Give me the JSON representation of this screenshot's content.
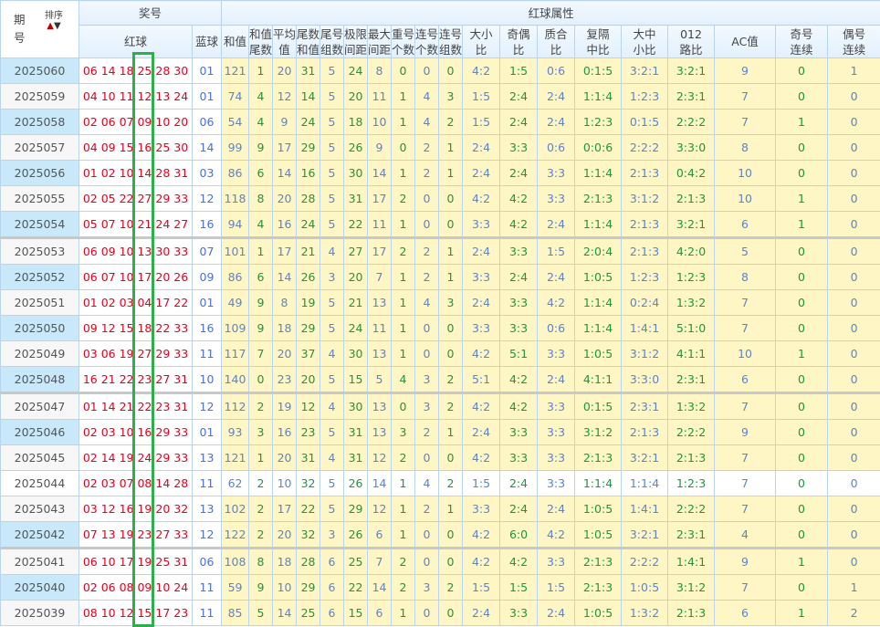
{
  "header": {
    "period_label_1": "期",
    "period_label_2": "号",
    "sort_label": "排序",
    "sort_up_icon": "▲",
    "sort_down_icon": "▼",
    "prize_group": "奖号",
    "attr_group": "红球属性",
    "red_label": "红球",
    "blue_label": "蓝球",
    "columns": [
      [
        "和值",
        ""
      ],
      [
        "和值",
        "尾数"
      ],
      [
        "平均",
        "值"
      ],
      [
        "尾数",
        "和值"
      ],
      [
        "尾号",
        "组数"
      ],
      [
        "极限",
        "间距"
      ],
      [
        "最大",
        "间距"
      ],
      [
        "重号",
        "个数"
      ],
      [
        "连号",
        "个数"
      ],
      [
        "连号",
        "组数"
      ],
      [
        "大小",
        "比"
      ],
      [
        "奇偶",
        "比"
      ],
      [
        "质合",
        "比"
      ],
      [
        "复隔",
        "中比"
      ],
      [
        "大中",
        "小比"
      ],
      [
        "012",
        "路比"
      ],
      [
        "AC值",
        ""
      ],
      [
        "奇号",
        "连续"
      ],
      [
        "偶号",
        "连续"
      ]
    ]
  },
  "colors": {
    "red": "#e8001c",
    "blue": "#4a6fe0",
    "attr_blue": "#5585d6",
    "attr_green": "#179a3c",
    "highlight": "#2db04b",
    "period_alt": "#c9e9fb",
    "attr_bg": "#fff6c6"
  },
  "rows": [
    {
      "period": "2025060",
      "reds": "06 14 18 25 28 30",
      "blue": "01",
      "attrs": [
        "121",
        "1",
        "20",
        "31",
        "5",
        "24",
        "8",
        "0",
        "0",
        "0",
        "4:2",
        "1:5",
        "0:6",
        "0:1:5",
        "3:2:1",
        "3:2:1",
        "9",
        "0",
        "1"
      ]
    },
    {
      "period": "2025059",
      "reds": "04 10 11 12 13 24",
      "blue": "01",
      "attrs": [
        "74",
        "4",
        "12",
        "14",
        "5",
        "20",
        "11",
        "1",
        "4",
        "3",
        "1:5",
        "2:4",
        "2:4",
        "1:1:4",
        "1:2:3",
        "2:3:1",
        "7",
        "0",
        "0"
      ]
    },
    {
      "period": "2025058",
      "reds": "02 06 07 09 10 20",
      "blue": "06",
      "attrs": [
        "54",
        "4",
        "9",
        "24",
        "5",
        "18",
        "10",
        "1",
        "4",
        "2",
        "1:5",
        "2:4",
        "2:4",
        "1:2:3",
        "0:1:5",
        "2:2:2",
        "7",
        "1",
        "0"
      ]
    },
    {
      "period": "2025057",
      "reds": "04 09 15 16 25 30",
      "blue": "14",
      "attrs": [
        "99",
        "9",
        "17",
        "29",
        "5",
        "26",
        "9",
        "0",
        "2",
        "1",
        "2:4",
        "3:3",
        "0:6",
        "0:0:6",
        "2:2:2",
        "3:3:0",
        "8",
        "0",
        "0"
      ]
    },
    {
      "period": "2025056",
      "reds": "01 02 10 14 28 31",
      "blue": "03",
      "attrs": [
        "86",
        "6",
        "14",
        "16",
        "5",
        "30",
        "14",
        "1",
        "2",
        "1",
        "2:4",
        "2:4",
        "3:3",
        "1:1:4",
        "2:1:3",
        "0:4:2",
        "10",
        "0",
        "0"
      ]
    },
    {
      "period": "2025055",
      "reds": "02 05 22 27 29 33",
      "blue": "12",
      "attrs": [
        "118",
        "8",
        "20",
        "28",
        "5",
        "31",
        "17",
        "2",
        "0",
        "0",
        "4:2",
        "4:2",
        "3:3",
        "2:1:3",
        "3:1:2",
        "2:1:3",
        "10",
        "1",
        "0"
      ]
    },
    {
      "period": "2025054",
      "reds": "05 07 10 21 24 27",
      "blue": "16",
      "attrs": [
        "94",
        "4",
        "16",
        "24",
        "5",
        "22",
        "11",
        "1",
        "0",
        "0",
        "3:3",
        "4:2",
        "2:4",
        "1:1:4",
        "2:1:3",
        "3:2:1",
        "6",
        "1",
        "0"
      ]
    },
    {
      "period": "2025053",
      "reds": "06 09 10 13 30 33",
      "blue": "07",
      "attrs": [
        "101",
        "1",
        "17",
        "21",
        "4",
        "27",
        "17",
        "2",
        "2",
        "1",
        "2:4",
        "3:3",
        "1:5",
        "2:0:4",
        "2:1:3",
        "4:2:0",
        "5",
        "0",
        "0"
      ]
    },
    {
      "period": "2025052",
      "reds": "06 07 10 17 20 26",
      "blue": "09",
      "attrs": [
        "86",
        "6",
        "14",
        "26",
        "3",
        "20",
        "7",
        "1",
        "2",
        "1",
        "3:3",
        "2:4",
        "2:4",
        "1:0:5",
        "1:2:3",
        "1:2:3",
        "8",
        "0",
        "0"
      ]
    },
    {
      "period": "2025051",
      "reds": "01 02 03 04 17 22",
      "blue": "01",
      "attrs": [
        "49",
        "9",
        "8",
        "19",
        "5",
        "21",
        "13",
        "1",
        "4",
        "3",
        "2:4",
        "3:3",
        "4:2",
        "1:1:4",
        "0:2:4",
        "1:3:2",
        "7",
        "0",
        "0"
      ]
    },
    {
      "period": "2025050",
      "reds": "09 12 15 18 22 33",
      "blue": "16",
      "attrs": [
        "109",
        "9",
        "18",
        "29",
        "5",
        "24",
        "11",
        "1",
        "0",
        "0",
        "3:3",
        "3:3",
        "0:6",
        "1:1:4",
        "1:4:1",
        "5:1:0",
        "7",
        "0",
        "0"
      ]
    },
    {
      "period": "2025049",
      "reds": "03 06 19 27 29 33",
      "blue": "11",
      "attrs": [
        "117",
        "7",
        "20",
        "37",
        "4",
        "30",
        "13",
        "1",
        "0",
        "0",
        "4:2",
        "5:1",
        "3:3",
        "1:0:5",
        "3:1:2",
        "4:1:1",
        "10",
        "1",
        "0"
      ]
    },
    {
      "period": "2025048",
      "reds": "16 21 22 23 27 31",
      "blue": "10",
      "attrs": [
        "140",
        "0",
        "23",
        "20",
        "5",
        "15",
        "5",
        "4",
        "3",
        "2",
        "5:1",
        "4:2",
        "2:4",
        "4:1:1",
        "3:3:0",
        "2:3:1",
        "6",
        "0",
        "0"
      ]
    },
    {
      "period": "2025047",
      "reds": "01 14 21 22 23 31",
      "blue": "12",
      "attrs": [
        "112",
        "2",
        "19",
        "12",
        "4",
        "30",
        "13",
        "0",
        "3",
        "2",
        "4:2",
        "4:2",
        "3:3",
        "0:1:5",
        "2:3:1",
        "1:3:2",
        "7",
        "0",
        "0"
      ]
    },
    {
      "period": "2025046",
      "reds": "02 03 10 16 29 33",
      "blue": "01",
      "attrs": [
        "93",
        "3",
        "16",
        "23",
        "5",
        "31",
        "13",
        "3",
        "2",
        "1",
        "2:4",
        "3:3",
        "3:3",
        "3:1:2",
        "2:1:3",
        "2:2:2",
        "9",
        "0",
        "0"
      ]
    },
    {
      "period": "2025045",
      "reds": "02 14 19 24 29 33",
      "blue": "13",
      "attrs": [
        "121",
        "1",
        "20",
        "31",
        "4",
        "31",
        "12",
        "2",
        "0",
        "0",
        "4:2",
        "3:3",
        "3:3",
        "2:1:3",
        "3:2:1",
        "2:1:3",
        "7",
        "0",
        "0"
      ]
    },
    {
      "period": "2025044",
      "reds": "02 03 07 08 14 28",
      "blue": "11",
      "attrs": [
        "62",
        "2",
        "10",
        "32",
        "5",
        "26",
        "14",
        "1",
        "4",
        "2",
        "1:5",
        "2:4",
        "3:3",
        "1:1:4",
        "1:1:4",
        "1:2:3",
        "7",
        "0",
        "0"
      ]
    },
    {
      "period": "2025043",
      "reds": "03 12 16 19 20 32",
      "blue": "13",
      "attrs": [
        "102",
        "2",
        "17",
        "22",
        "5",
        "29",
        "12",
        "1",
        "2",
        "1",
        "3:3",
        "2:4",
        "2:4",
        "1:0:5",
        "1:4:1",
        "2:2:2",
        "7",
        "0",
        "0"
      ]
    },
    {
      "period": "2025042",
      "reds": "07 13 19 23 27 33",
      "blue": "12",
      "attrs": [
        "122",
        "2",
        "20",
        "32",
        "3",
        "26",
        "6",
        "1",
        "0",
        "0",
        "4:2",
        "6:0",
        "4:2",
        "1:0:5",
        "3:2:1",
        "2:3:1",
        "4",
        "0",
        "0"
      ]
    },
    {
      "period": "2025041",
      "reds": "06 10 17 19 25 31",
      "blue": "06",
      "attrs": [
        "108",
        "8",
        "18",
        "28",
        "6",
        "25",
        "7",
        "2",
        "0",
        "0",
        "4:2",
        "4:2",
        "3:3",
        "2:1:3",
        "2:2:2",
        "1:4:1",
        "9",
        "1",
        "0"
      ]
    },
    {
      "period": "2025040",
      "reds": "02 06 08 09 10 24",
      "blue": "11",
      "attrs": [
        "59",
        "9",
        "10",
        "29",
        "6",
        "22",
        "14",
        "2",
        "3",
        "2",
        "1:5",
        "1:5",
        "1:5",
        "2:1:3",
        "1:0:5",
        "3:1:2",
        "7",
        "0",
        "1"
      ]
    },
    {
      "period": "2025039",
      "reds": "08 10 12 15 17 23",
      "blue": "11",
      "attrs": [
        "85",
        "5",
        "14",
        "25",
        "6",
        "15",
        "6",
        "1",
        "0",
        "0",
        "2:4",
        "3:3",
        "2:4",
        "1:0:5",
        "1:3:2",
        "2:1:3",
        "6",
        "1",
        "2"
      ]
    }
  ]
}
